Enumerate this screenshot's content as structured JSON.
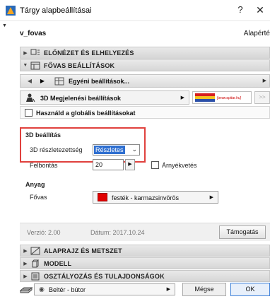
{
  "window": {
    "title": "Tárgy alapbeállításai",
    "help_label": "?",
    "close_label": "✕"
  },
  "header": {
    "object_name": "v_fovas",
    "default_label": "Alapérté"
  },
  "sections": {
    "preview": "ELŐNÉZET ÉS ELHELYEZÉS",
    "main": "FŐVAS BEÁLLÍTÁSOK",
    "floorplan": "ALAPRAJZ ÉS METSZET",
    "model": "MODELL",
    "classification": "OSZTÁLYOZÁS ÉS TULAJDONSÁGOK"
  },
  "toolbar": {
    "prev_label": "◀",
    "next_label": "▶",
    "custom_settings": "Egyéni beállítások..."
  },
  "settings_row": {
    "dropdown_label": "3D Megjelenési beállítások",
    "logo_url": "[www.epitar.hu]",
    "prev_page": "<<",
    "next_page": ">>"
  },
  "global": {
    "label": "Használd a globális beállításokat",
    "checked": false
  },
  "params": {
    "section_3d": "3D beállítás",
    "detail_label": "3D részletezettség",
    "detail_value": "Részletes",
    "resolution_label": "Felbontás",
    "resolution_value": "20",
    "shadow_label": "Árnyékvetés",
    "shadow_checked": false,
    "material_section": "Anyag",
    "material_label": "Fővas",
    "material_value": "festék - karmazsinvörös",
    "material_color": "#e00000"
  },
  "footer": {
    "version": "Verzió: 2.00",
    "date": "Dátum: 2017.10.24",
    "support": "Támogatás"
  },
  "bottom": {
    "layer": "Beltér - bútor",
    "cancel": "Mégse",
    "ok": "OK"
  },
  "colors": {
    "highlight_border": "#e0413d",
    "selection_blue": "#2f6fd0",
    "ok_border": "#3c7fd8"
  }
}
